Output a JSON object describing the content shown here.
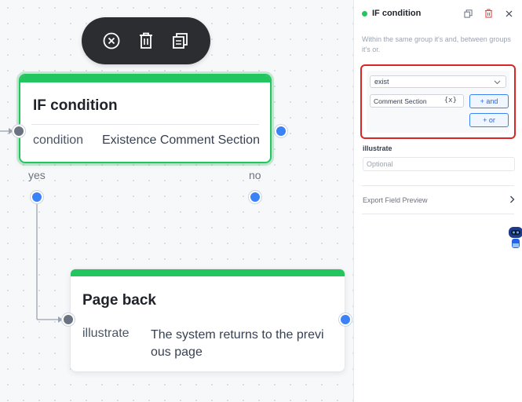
{
  "canvas": {
    "if_node": {
      "title": "IF condition",
      "row_key": "condition",
      "row_value": "Existence Comment Section",
      "branch_yes": "yes",
      "branch_no": "no"
    },
    "page_node": {
      "title": "Page back",
      "row_key": "illustrate",
      "row_value_line1": "The system returns to the previ",
      "row_value_line2": "ous page"
    },
    "toolbar": {
      "icons": [
        "close-circle-icon",
        "trash-icon",
        "copy-icon"
      ]
    }
  },
  "panel": {
    "title": "IF condition",
    "hint": "Within the same group it's and, between groups it's or.",
    "condition": {
      "operator": "exist",
      "field": "Comment Section",
      "var_tag": "{x}",
      "and_label": "+ and",
      "or_label": "+ or"
    },
    "illustrate_label": "illustrate",
    "illustrate_placeholder": "Optional",
    "export_label": "Export Field Preview"
  },
  "colors": {
    "accent_green": "#22c55e",
    "accent_blue": "#3b82f6",
    "highlight_red": "#dc2626",
    "toolbar_bg": "#2b2d31"
  }
}
